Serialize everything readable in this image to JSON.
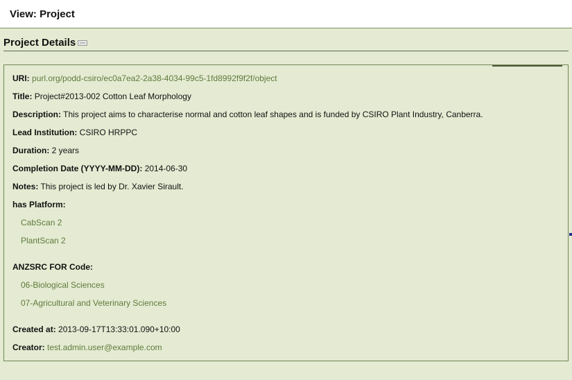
{
  "header": {
    "title": "View: Project"
  },
  "section": {
    "title": "Project Details",
    "edit_icon": "edit-icon"
  },
  "details": {
    "uri": {
      "label": "URI:",
      "value": "purl.org/podd-csiro/ec0a7ea2-2a38-4034-99c5-1fd8992f9f2f/object"
    },
    "title": {
      "label": "Title:",
      "value": "Project#2013-002 Cotton Leaf Morphology"
    },
    "description": {
      "label": "Description:",
      "value": "This project aims to characterise normal and cotton leaf shapes and is funded by CSIRO Plant Industry, Canberra."
    },
    "lead_institution": {
      "label": "Lead Institution:",
      "value": "CSIRO HRPPC"
    },
    "duration": {
      "label": "Duration:",
      "value": "2 years"
    },
    "completion_date": {
      "label": "Completion Date (YYYY-MM-DD):",
      "value": "2014-06-30"
    },
    "notes": {
      "label": "Notes:",
      "value": "This project is led by Dr. Xavier Sirault."
    },
    "has_platform": {
      "label": "has Platform:",
      "items": [
        "CabScan 2",
        "PlantScan 2"
      ]
    },
    "anzsrc": {
      "label": "ANZSRC FOR Code:",
      "items": [
        "06-Biological Sciences",
        "07-Agricultural and Veterinary Sciences"
      ]
    },
    "created_at": {
      "label": "Created at:",
      "value": "2013-09-17T13:33:01.090+10:00"
    },
    "creator": {
      "label": "Creator:",
      "value": "test.admin.user@example.com"
    }
  },
  "colors": {
    "background": "#e4ebd2",
    "link": "#5f7a3c",
    "border": "#6f8356"
  }
}
